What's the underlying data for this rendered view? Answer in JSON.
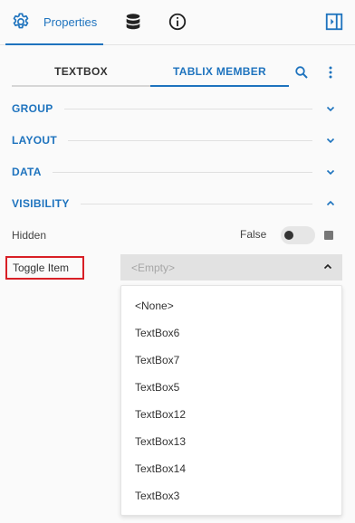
{
  "toolbar": {
    "properties_label": "Properties",
    "icons": [
      "gear-icon",
      "database-icon",
      "info-icon",
      "collapse-panel-icon"
    ],
    "accent": "#1e73be"
  },
  "subtabs": {
    "textbox": "TEXTBOX",
    "tablix_member": "TABLIX MEMBER",
    "active": "TABLIX MEMBER"
  },
  "sections": {
    "group": "GROUP",
    "layout": "LAYOUT",
    "data": "DATA",
    "visibility": "VISIBILITY"
  },
  "hidden": {
    "label": "Hidden",
    "value": "False"
  },
  "toggle_item": {
    "label": "Toggle Item",
    "placeholder": "<Empty>",
    "highlight_color": "#d81f26",
    "options": [
      "<None>",
      "TextBox6",
      "TextBox7",
      "TextBox5",
      "TextBox12",
      "TextBox13",
      "TextBox14",
      "TextBox3"
    ]
  }
}
